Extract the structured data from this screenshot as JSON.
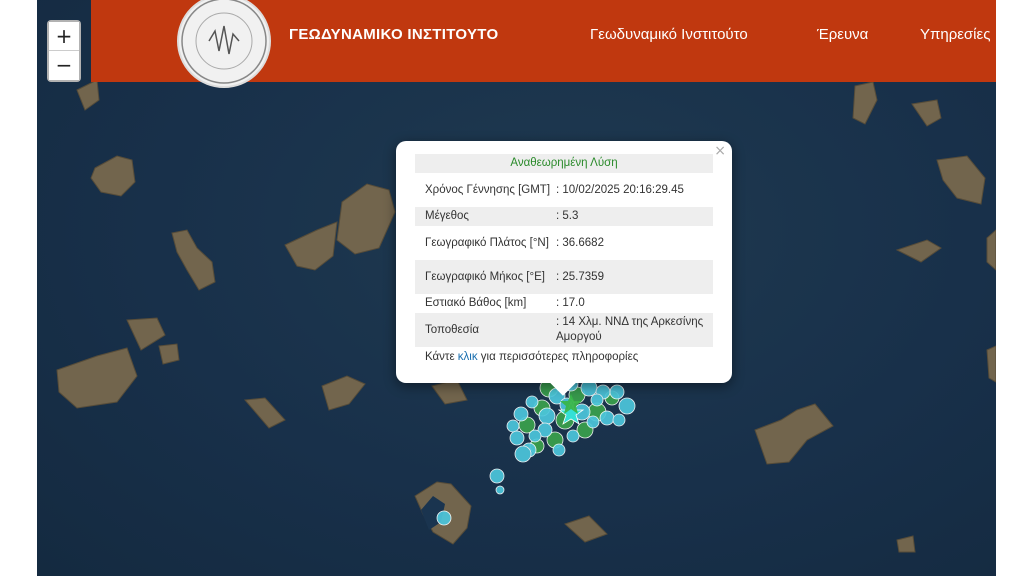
{
  "header": {
    "brand": "ΓΕΩΔΥΝΑΜΙΚΟ ΙΝΣΤΙΤΟΥΤΟ",
    "nav": [
      "Γεωδυναμικό Ινστιτούτο",
      "Έρευνα",
      "Υπηρεσίες"
    ],
    "background_color": "#c0380f"
  },
  "map_controls": {
    "zoom_in": "+",
    "zoom_out": "−"
  },
  "popup": {
    "close": "×",
    "title": "Αναθεωρημένη Λύση",
    "rows": [
      {
        "label": "Χρόνος Γέννησης [GMT]",
        "value": ": 10/02/2025 20:16:29.45"
      },
      {
        "label": "Μέγεθος",
        "value": ": 5.3"
      },
      {
        "label": "Γεωγραφικό Πλάτος [°N]",
        "value": ": 36.6682"
      },
      {
        "label": "Γεωγραφικό Μήκος [°E]",
        "value": ": 25.7359"
      },
      {
        "label": "Εστιακό Βάθος [km]",
        "value": ": 17.0"
      },
      {
        "label": "Τοποθεσία",
        "value": ": 14 Χλμ. ΝΝΔ της Αρκεσίνης Αμοργού"
      }
    ],
    "more_prefix": "Κάντε ",
    "more_link": "κλικ",
    "more_suffix": " για περισσότερες πληροφορίες"
  },
  "markers": {
    "cyan_color": "#4cc6dc",
    "green_color": "#3aa14c",
    "epicenter_star_colors": [
      "#35e0d6",
      "#3ab54a"
    ]
  }
}
